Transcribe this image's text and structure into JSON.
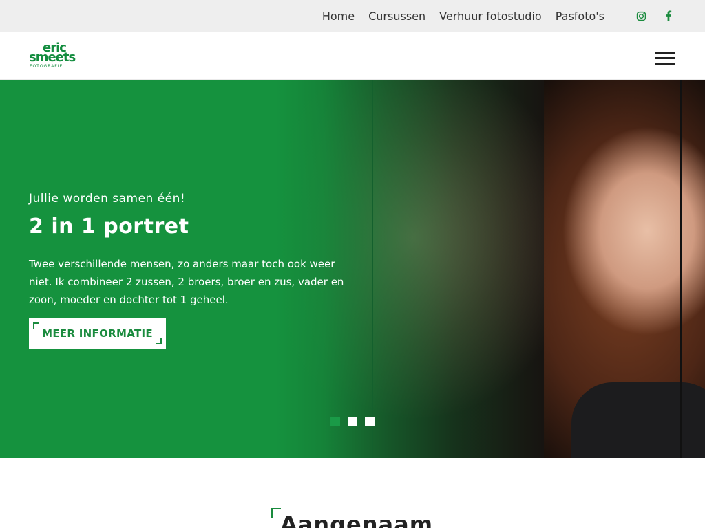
{
  "topnav": {
    "links": [
      {
        "label": "Home"
      },
      {
        "label": "Cursussen"
      },
      {
        "label": "Verhuur fotostudio"
      },
      {
        "label": "Pasfoto's"
      }
    ],
    "social": [
      {
        "icon": "instagram-icon"
      },
      {
        "icon": "facebook-icon"
      }
    ]
  },
  "logo": {
    "line1": "eric",
    "line2": "smeets",
    "line3": "FOTOGRAFIE"
  },
  "header": {
    "menu_icon": "hamburger-menu-icon"
  },
  "hero": {
    "kicker": "Jullie worden samen één!",
    "title": "2 in 1 portret",
    "description": "Twee verschillende mensen, zo anders maar toch ook weer niet. Ik combineer 2 zussen, 2 broers, broer en zus, vader en zoon, moeder en dochter tot 1 geheel.",
    "cta_label": "MEER INFORMATIE",
    "slides": 3,
    "active_slide": 1
  },
  "section": {
    "title": "Aangenaam"
  },
  "colors": {
    "brand_green": "#15923e",
    "topbar_bg": "#eeeeee",
    "text_dark": "#333333"
  }
}
